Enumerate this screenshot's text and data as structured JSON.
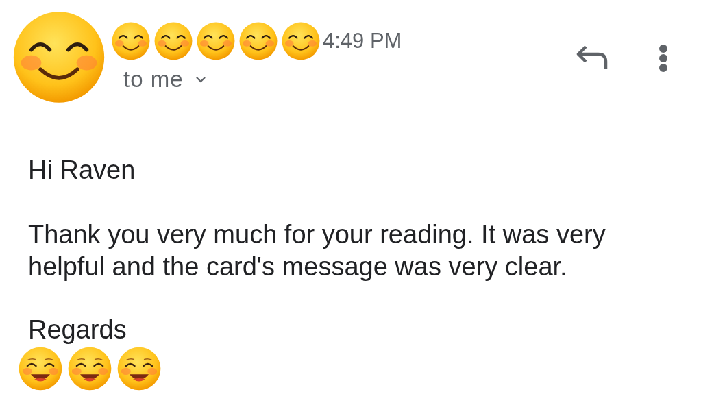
{
  "header": {
    "time": "4:49 PM",
    "recipient": "to me"
  },
  "body": {
    "greeting": "Hi Raven",
    "paragraphs": [
      "Thank you very much for your reading. It was very helpful and the card's message was very clear."
    ],
    "closing": "Regards"
  }
}
